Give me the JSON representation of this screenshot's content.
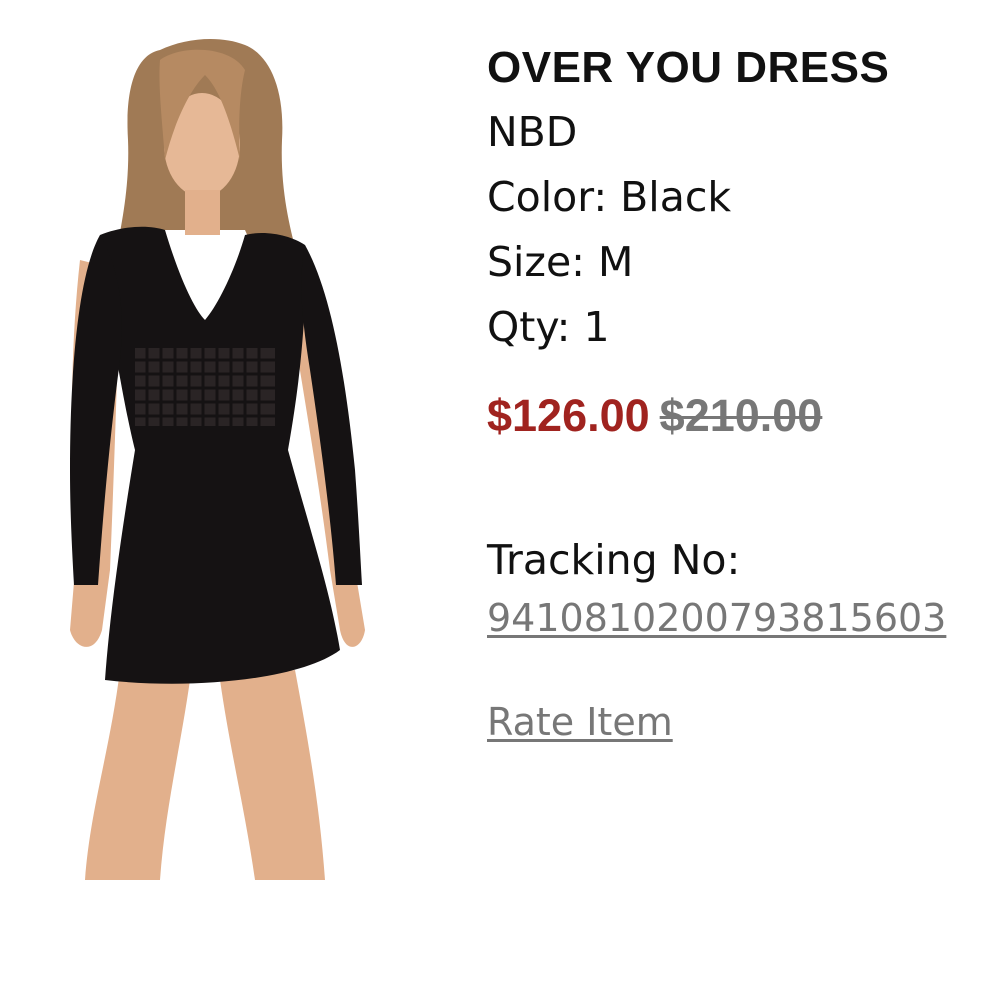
{
  "product": {
    "image_icon": "product-photo",
    "title": "OVER YOU DRESS",
    "brand": "NBD",
    "color_line": "Color: Black",
    "size_line": "Size: M",
    "qty_line": "Qty: 1",
    "sale_price": "$126.00",
    "original_price": "$210.00",
    "sale_color": "#a0231f",
    "original_color": "#777777"
  },
  "tracking": {
    "label": "Tracking No:",
    "number": "9410810200793815603"
  },
  "actions": {
    "rate_label": "Rate Item"
  }
}
